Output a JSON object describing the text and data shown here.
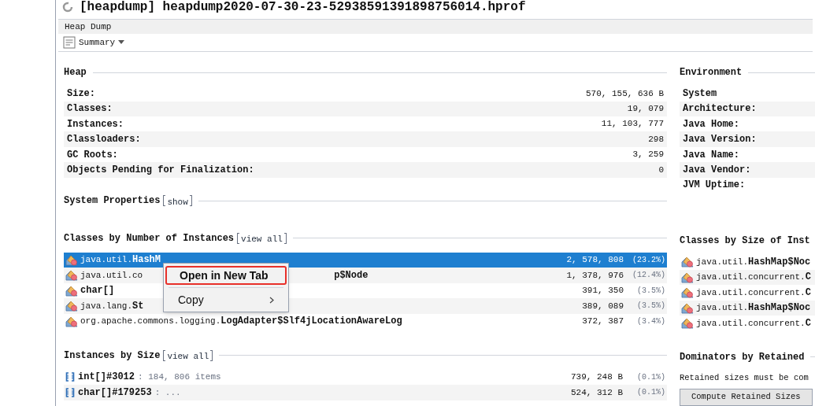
{
  "window": {
    "title": "[heapdump] heapdump2020-07-30-23-52938591391898756014.hprof"
  },
  "tab_bar": {
    "label": "Heap Dump"
  },
  "view_selector": {
    "label": "Summary"
  },
  "heap": {
    "title": "Heap",
    "rows": [
      {
        "label": "Size:",
        "value": "570, 155, 636 B"
      },
      {
        "label": "Classes:",
        "value": "19, 079"
      },
      {
        "label": "Instances:",
        "value": "11, 103, 777"
      },
      {
        "label": "Classloaders:",
        "value": "298"
      },
      {
        "label": "GC Roots:",
        "value": "3, 259"
      },
      {
        "label": "Objects Pending for Finalization:",
        "value": "0"
      }
    ]
  },
  "system_properties": {
    "title": "System Properties",
    "link": "show"
  },
  "classes_by_instances": {
    "title": "Classes by Number of Instances",
    "link": "view all",
    "rows": [
      {
        "package": "java.util.",
        "name": "HashM",
        "tail": "",
        "count": "2, 578, 808",
        "percent": "(23.2%)",
        "selected": true
      },
      {
        "package": "java.util.co",
        "name": "",
        "tail": "p$Node",
        "count": "1, 378, 976",
        "percent": "(12.4%)",
        "selected": false
      },
      {
        "package": "",
        "name": "char[]",
        "tail": "",
        "count": "391, 350",
        "percent": "(3.5%)",
        "selected": false
      },
      {
        "package": "java.lang.",
        "name": "St",
        "tail": "",
        "count": "389, 089",
        "percent": "(3.5%)",
        "selected": false
      },
      {
        "package": "org.apache.commons.logging.",
        "name": "LogAdapter$Slf4jLocationAwareLog",
        "tail": "",
        "count": "372, 387",
        "percent": "(3.4%)",
        "selected": false
      }
    ]
  },
  "context_menu": {
    "items": [
      {
        "label": "Open in New Tab",
        "highlighted": true,
        "submenu": false
      },
      {
        "label": "Copy",
        "highlighted": false,
        "submenu": true
      }
    ]
  },
  "instances_by_size": {
    "title": "Instances by Size",
    "link": "view all",
    "rows": [
      {
        "name": "int[]#3012",
        "detail": ": 184, 806 items",
        "size": "739, 248 B",
        "percent": "(0.1%)"
      },
      {
        "name": "char[]#179253",
        "detail": ": ...",
        "size": "524, 312 B",
        "percent": "(0.1%)"
      }
    ]
  },
  "environment": {
    "title": "Environment",
    "rows": [
      "System",
      "Architecture:",
      "Java Home:",
      "Java Version:",
      "Java Name:",
      "Java Vendor:",
      "JVM Uptime:"
    ]
  },
  "classes_by_size": {
    "title": "Classes by Size of Inst",
    "rows": [
      {
        "package": "java.util.",
        "name": "HashMap$Noc"
      },
      {
        "package": "java.util.concurrent.",
        "name": "C"
      },
      {
        "package": "java.util.concurrent.",
        "name": "C"
      },
      {
        "package": "java.util.",
        "name": "HashMap$Noc"
      },
      {
        "package": "java.util.concurrent.",
        "name": "C"
      }
    ]
  },
  "dominators": {
    "title": "Dominators by Retained",
    "note": "Retained sizes must be com",
    "button": "Compute Retained Sizes"
  }
}
